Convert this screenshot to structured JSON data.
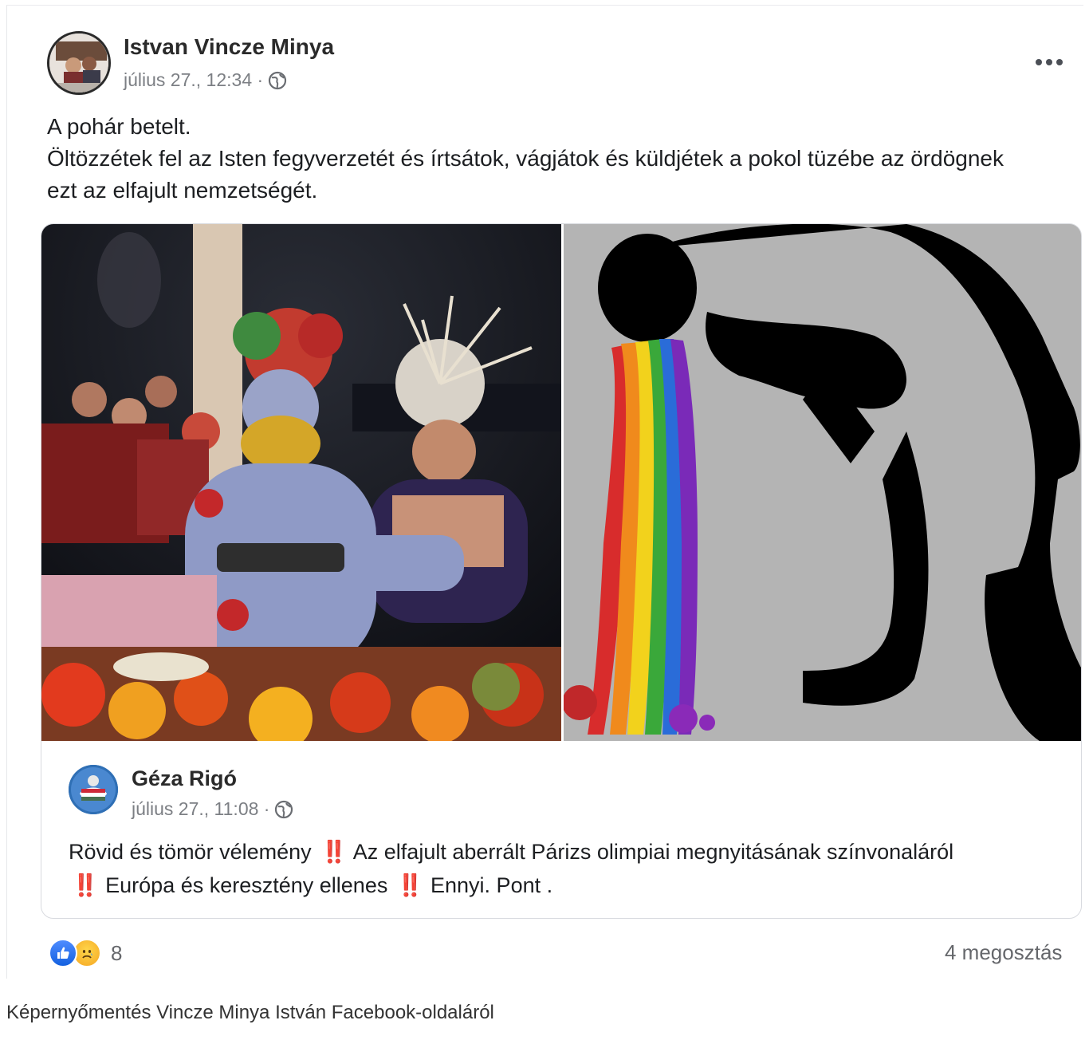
{
  "post": {
    "author": "Istvan Vincze Minya",
    "timestamp": "július 27., 12:34 ·",
    "privacy_icon": "globe-icon",
    "more_icon": "more-horizontal-icon",
    "text_lines": [
      "A pohár betelt.",
      "Öltözzétek fel az Isten fegyverzetét és írtsátok, vágjátok és küldjétek a pokol tüzébe az ördögnek",
      "ezt az elfajult nemzetségét."
    ]
  },
  "shared_post": {
    "author": "Géza Rigó",
    "timestamp": "július 27., 11:08 ·",
    "privacy_icon": "globe-icon",
    "text_line1_a": "Rövid és tömör vélemény",
    "text_line1_b": "Az elfajult aberrált Párizs olimpiai megnyitásának színvonaláról",
    "text_line2_a": "Európa és keresztény ellenes",
    "text_line2_b": "Ennyi. Pont .",
    "emphasis_glyph": "‼️"
  },
  "footer": {
    "reaction_icons": [
      "like-icon",
      "sad-icon"
    ],
    "reaction_count": "8",
    "shares": "4 megosztás"
  },
  "caption": "Képernyőmentés Vincze Minya István Facebook-oldaláról",
  "colors": {
    "like_blue": "#1877f2",
    "emphasis_red": "#d62828",
    "meta_gray": "#7c7f84"
  }
}
